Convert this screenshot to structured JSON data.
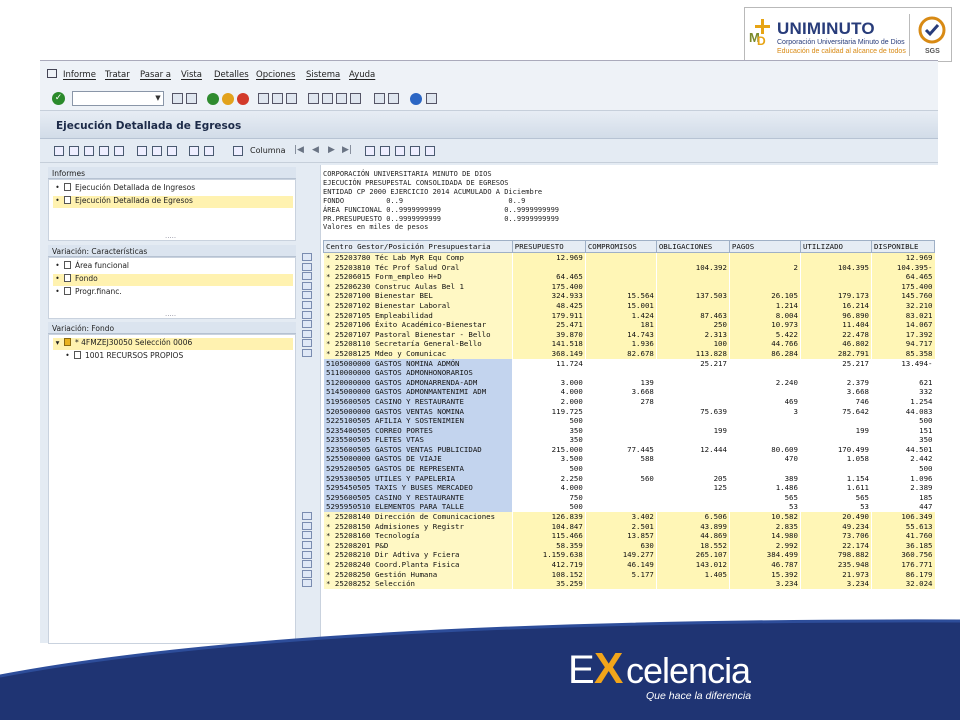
{
  "logo": {
    "name": "UNIMINUTO",
    "sub1": "Corporación Universitaria Minuto de Dios",
    "sub2": "Educación de calidad al alcance de todos",
    "mark_letters": "MD",
    "cert": "SGS",
    "colors": {
      "navy": "#283c7a",
      "gold": "#e7a414",
      "olive": "#7a8a2a"
    }
  },
  "menu": [
    "Informe",
    "Tratar",
    "Pasar a",
    "Vista",
    "Detalles",
    "Opciones",
    "Sistema",
    "Ayuda"
  ],
  "title": "Ejecución Detallada de Egresos",
  "toolbar": {
    "columna_label": "Columna"
  },
  "panels": {
    "informes": {
      "title": "Informes",
      "items": [
        {
          "label": "Ejecución Detallada de Ingresos",
          "selected": false
        },
        {
          "label": "Ejecución Detallada de Egresos",
          "selected": true
        }
      ]
    },
    "caracteristicas": {
      "title": "Variación: Características",
      "items": [
        {
          "label": "Área funcional",
          "selected": false
        },
        {
          "label": "Fondo",
          "selected": true
        },
        {
          "label": "Progr.financ.",
          "selected": false
        }
      ]
    },
    "fondo": {
      "title": "Variación: Fondo",
      "items": [
        {
          "label": "* 4FMZEJ30050 Selección    0006",
          "selected": true
        },
        {
          "label": "1001 RECURSOS PROPIOS",
          "selected": false
        }
      ]
    }
  },
  "report": {
    "header_lines": [
      "CORPORACIÓN UNIVERSITARIA MINUTO DE DIOS",
      "EJECUCIÓN PRESUPESTAL CONSOLIDADA DE EGRESOS",
      "ENTIDAD CP 2000 EJERCICIO 2014 ACUMULADO A Diciembre",
      "FONDO          0..9                         0..9",
      "ÁREA FUNCIONAL 0..9999999999               0..9999999999",
      "PR.PRESUPUESTO 0..9999999999               0..9999999999",
      "Valores en miles de pesos"
    ],
    "columns": [
      "Centro Gestor/Posición Presupuestaria",
      "PRESUPUESTO",
      "COMPROMISOS",
      "OBLIGACIONES",
      "PAGOS",
      "UTILIZADO",
      "DISPONIBLE"
    ],
    "rows": [
      {
        "k": "y",
        "c": "*  25203780  Téc Lab MyR Equ Comp",
        "v": [
          "12.969",
          "",
          "",
          "",
          "",
          "12.969"
        ]
      },
      {
        "k": "y",
        "c": "*  25203810  Téc Prof Salud Oral",
        "v": [
          "",
          "",
          "104.392",
          "2",
          "104.395",
          "104.395-"
        ]
      },
      {
        "k": "y",
        "c": "*  25206015  Form_empleo H+D",
        "v": [
          "64.465",
          "",
          "",
          "",
          "",
          "64.465"
        ]
      },
      {
        "k": "y",
        "c": "*  25206230  Construc Aulas Bel 1",
        "v": [
          "175.400",
          "",
          "",
          "",
          "",
          "175.400"
        ]
      },
      {
        "k": "y",
        "c": "*  25207100  Bienestar BEL",
        "v": [
          "324.933",
          "15.564",
          "137.503",
          "26.105",
          "179.173",
          "145.760"
        ]
      },
      {
        "k": "y",
        "c": "*  25207102  Bienestar Laboral",
        "v": [
          "48.425",
          "15.001",
          "",
          "1.214",
          "16.214",
          "32.210"
        ]
      },
      {
        "k": "y",
        "c": "*  25207105  Empleabilidad",
        "v": [
          "179.911",
          "1.424",
          "87.463",
          "8.004",
          "96.890",
          "83.021"
        ]
      },
      {
        "k": "y",
        "c": "*  25207106  Éxito Académico-Bienestar",
        "v": [
          "25.471",
          "181",
          "250",
          "10.973",
          "11.404",
          "14.067"
        ]
      },
      {
        "k": "y",
        "c": "*  25207107  Pastoral Bienestar - Bello",
        "v": [
          "39.870",
          "14.743",
          "2.313",
          "5.422",
          "22.478",
          "17.392"
        ]
      },
      {
        "k": "y",
        "c": "*  25208110  Secretaría General-Bello",
        "v": [
          "141.518",
          "1.936",
          "100",
          "44.766",
          "46.802",
          "94.717"
        ]
      },
      {
        "k": "y",
        "c": "*  25208125  Mdeo y Comunicac",
        "v": [
          "368.149",
          "82.678",
          "113.828",
          "86.284",
          "282.791",
          "85.358"
        ]
      },
      {
        "k": "b",
        "c": "   5105000000  GASTOS NOMINA ADMÓN",
        "v": [
          "11.724",
          "",
          "25.217",
          "",
          "25.217",
          "13.494-"
        ]
      },
      {
        "k": "b",
        "c": "   5110000000  GASTOS ADMONHONORARIOS",
        "v": [
          "",
          "",
          "",
          "",
          "",
          ""
        ]
      },
      {
        "k": "b",
        "c": "   5120000000  GASTOS ADMONARRENDA-ADM",
        "v": [
          "3.000",
          "139",
          "",
          "2.240",
          "2.379",
          "621"
        ]
      },
      {
        "k": "b",
        "c": "   5145000000  GASTOS ADMONMANTENIMI ADM",
        "v": [
          "4.000",
          "3.668",
          "",
          "",
          "3.668",
          "332"
        ]
      },
      {
        "k": "b",
        "c": "   5195600505  CASINO Y RESTAURANTE",
        "v": [
          "2.000",
          "278",
          "",
          "469",
          "746",
          "1.254"
        ]
      },
      {
        "k": "b",
        "c": "   5205000000  GASTOS VENTAS NOMINA",
        "v": [
          "119.725",
          "",
          "75.639",
          "3",
          "75.642",
          "44.083"
        ]
      },
      {
        "k": "b",
        "c": "   5225100505  AFILIA Y SOSTENIMIEN",
        "v": [
          "500",
          "",
          "",
          "",
          "",
          "500"
        ]
      },
      {
        "k": "b",
        "c": "   5235400505  CORREO PORTES",
        "v": [
          "350",
          "",
          "199",
          "",
          "199",
          "151"
        ]
      },
      {
        "k": "b",
        "c": "   5235500505  FLETES VTAS",
        "v": [
          "350",
          "",
          "",
          "",
          "",
          "350"
        ]
      },
      {
        "k": "b",
        "c": "   5235600505  GASTOS VENTAS  PUBLICIDAD",
        "v": [
          "215.000",
          "77.445",
          "12.444",
          "80.609",
          "170.499",
          "44.501"
        ]
      },
      {
        "k": "b",
        "c": "   5255000000  GASTOS DE VIAJE",
        "v": [
          "3.500",
          "588",
          "",
          "470",
          "1.058",
          "2.442"
        ]
      },
      {
        "k": "b",
        "c": "   5295200505  GASTOS DE REPRESENTA",
        "v": [
          "500",
          "",
          "",
          "",
          "",
          "500"
        ]
      },
      {
        "k": "b",
        "c": "   5295300505  UTILES Y PAPELERIA",
        "v": [
          "2.250",
          "560",
          "205",
          "389",
          "1.154",
          "1.096"
        ]
      },
      {
        "k": "b",
        "c": "   5295450505  TAXIS Y BUSES MERCADEO",
        "v": [
          "4.000",
          "",
          "125",
          "1.486",
          "1.611",
          "2.389"
        ]
      },
      {
        "k": "b",
        "c": "   5295600505  CASINO Y RESTAURANTE",
        "v": [
          "750",
          "",
          "",
          "565",
          "565",
          "185"
        ]
      },
      {
        "k": "b",
        "c": "   5295950510  ELEMENTOS PARA TALLE",
        "v": [
          "500",
          "",
          "",
          "53",
          "53",
          "447"
        ]
      },
      {
        "k": "y",
        "c": "*  25208140  Dirección de Comunicaciones",
        "v": [
          "126.839",
          "3.402",
          "6.506",
          "10.582",
          "20.490",
          "106.349"
        ]
      },
      {
        "k": "y",
        "c": "*  25208150  Admisiones y Registr",
        "v": [
          "104.847",
          "2.501",
          "43.899",
          "2.835",
          "49.234",
          "55.613"
        ]
      },
      {
        "k": "y",
        "c": "*  25208160  Tecnología",
        "v": [
          "115.466",
          "13.857",
          "44.869",
          "14.980",
          "73.706",
          "41.760"
        ]
      },
      {
        "k": "y",
        "c": "*  25208201  P&D",
        "v": [
          "58.359",
          "630",
          "18.552",
          "2.992",
          "22.174",
          "36.185"
        ]
      },
      {
        "k": "y",
        "c": "*  25208210  Dir Adtiva y Fciera",
        "v": [
          "1.159.638",
          "149.277",
          "265.107",
          "384.499",
          "798.882",
          "360.756"
        ]
      },
      {
        "k": "y",
        "c": "*  25208240  Coord.Planta Fisica",
        "v": [
          "412.719",
          "46.149",
          "143.012",
          "46.787",
          "235.948",
          "176.771"
        ]
      },
      {
        "k": "y",
        "c": "*  25208250  Gestión Humana",
        "v": [
          "108.152",
          "5.177",
          "1.405",
          "15.392",
          "21.973",
          "86.179"
        ]
      },
      {
        "k": "y",
        "c": "*  25208252  Selección",
        "v": [
          "35.259",
          "",
          "",
          "3.234",
          "3.234",
          "32.024"
        ]
      }
    ]
  },
  "footer": {
    "brand_e": "E",
    "brand_x": "X",
    "brand_rest": "celencia",
    "tagline": "Que hace la diferencia",
    "colors": {
      "navy": "#1f3473",
      "orange": "#f2a51a"
    }
  }
}
